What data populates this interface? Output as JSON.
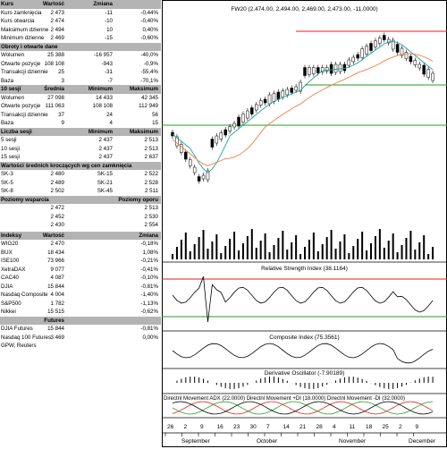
{
  "kurs": {
    "headers": [
      "Kurs",
      "Wartość",
      "Zmiana"
    ],
    "rows": [
      [
        "Kurs zamknięcia",
        "2 473",
        "-11",
        "-0,44%"
      ],
      [
        "Kurs otwarcia",
        "2 474",
        "-10",
        "-0,40%"
      ],
      [
        "Maksimum dzienne",
        "2 494",
        "10",
        "0,40%"
      ],
      [
        "Minimum dzienne",
        "2 469",
        "-15",
        "-0,60%"
      ]
    ]
  },
  "obroty": {
    "headers": [
      "Obroty i otwarte dane"
    ],
    "rows": [
      [
        "Wolumen",
        "25 388",
        "-16 957",
        "-40,0%"
      ],
      [
        "Otwarte pozycje",
        "108 108",
        "-943",
        "-0,9%"
      ],
      [
        "Transakcji dziennie",
        "25",
        "-31",
        "-55,4%"
      ],
      [
        "Baza",
        "3",
        "-7",
        "-70,1%"
      ]
    ]
  },
  "sesje10": {
    "headers": [
      "10 sesji",
      "Średnia",
      "Minimum",
      "Maksimum"
    ],
    "rows": [
      [
        "Wolumen",
        "27 098",
        "14 433",
        "42 345"
      ],
      [
        "Otwarte pozycje",
        "111 063",
        "108 108",
        "112 949"
      ],
      [
        "Transakcji dziennie",
        "37",
        "24",
        "56"
      ],
      [
        "Baza",
        "9",
        "4",
        "15"
      ]
    ]
  },
  "liczba_sesji": {
    "headers": [
      "Liczba sesji",
      "Minimum",
      "Maksimum"
    ],
    "rows": [
      [
        "5 sesji",
        "2 437",
        "2 513"
      ],
      [
        "10 sesji",
        "2 437",
        "2 513"
      ],
      [
        "15 sesji",
        "2 437",
        "2 637"
      ]
    ]
  },
  "srednie": {
    "header": "Wartości średnich kroczących wg cen zamknięcia",
    "rows": [
      [
        "SK-3",
        "2 480",
        "SK-15",
        "2 522"
      ],
      [
        "SK-5",
        "2 489",
        "SK-21",
        "2 528"
      ],
      [
        "SK-8",
        "2 502",
        "SK-45",
        "2 511"
      ]
    ]
  },
  "poziomy": {
    "headers": [
      "Poziomy wsparcia",
      "Poziomy oporu"
    ],
    "rows": [
      [
        "2 472",
        "2 513"
      ],
      [
        "2 452",
        "2 530"
      ],
      [
        "2 430",
        "2 554"
      ]
    ]
  },
  "indeksy": {
    "headers": [
      "Indeksy",
      "Wartość",
      "Zmiana"
    ],
    "rows": [
      [
        "WIG20",
        "2 470",
        "-0,18%"
      ],
      [
        "BUX",
        "18 434",
        "1,08%"
      ],
      [
        "ISE100",
        "73 966",
        "-0,21%"
      ],
      [
        "XetraDAX",
        "9 077",
        "-0,41%"
      ],
      [
        "CAC40",
        "4 087",
        "-0,10%"
      ],
      [
        "DJIA",
        "15 844",
        "-0,81%"
      ],
      [
        "Nasdaq Composite",
        "4 004",
        "-1,40%"
      ],
      [
        "S&P500",
        "1 782",
        "-1,13%"
      ],
      [
        "Nikkei",
        "15 515",
        "-0,62%"
      ]
    ]
  },
  "futures": {
    "headers": [
      "Futures"
    ],
    "rows": [
      [
        "DJIA Futures",
        "15 844",
        "-0,81%"
      ],
      [
        "Nasdaq 100 Futures",
        "3 469",
        "0,00%"
      ]
    ]
  },
  "source": "GPW, Reuters",
  "charts": {
    "main_title": "FW20 (2,474.00, 2,494.00, 2,469.00, 2,473.00, -11.0000)",
    "rsi_title": "Relative Strength Index (38.1164)",
    "composite_title": "Composite Index (75.3561)",
    "derivative_title": "Derivative Oscillator (-7.90189)",
    "dmi_title": "Directnl Movement ADX (22.0000) Directnl Movement +DI (18.0000) Directnl Movement -DI (32.0000)",
    "x_ticks": [
      "26",
      "2",
      "9",
      "16",
      "23",
      "30",
      "7",
      "14",
      "21",
      "28",
      "4",
      "11",
      "18",
      "25",
      "2",
      "9"
    ],
    "months": [
      "September",
      "October",
      "November",
      "December"
    ]
  },
  "colors": {
    "header_gray": "#b4b4b4",
    "red": "#e0201c",
    "green": "#2a9a2a",
    "orange": "#f08040",
    "teal": "#20a0a0"
  }
}
